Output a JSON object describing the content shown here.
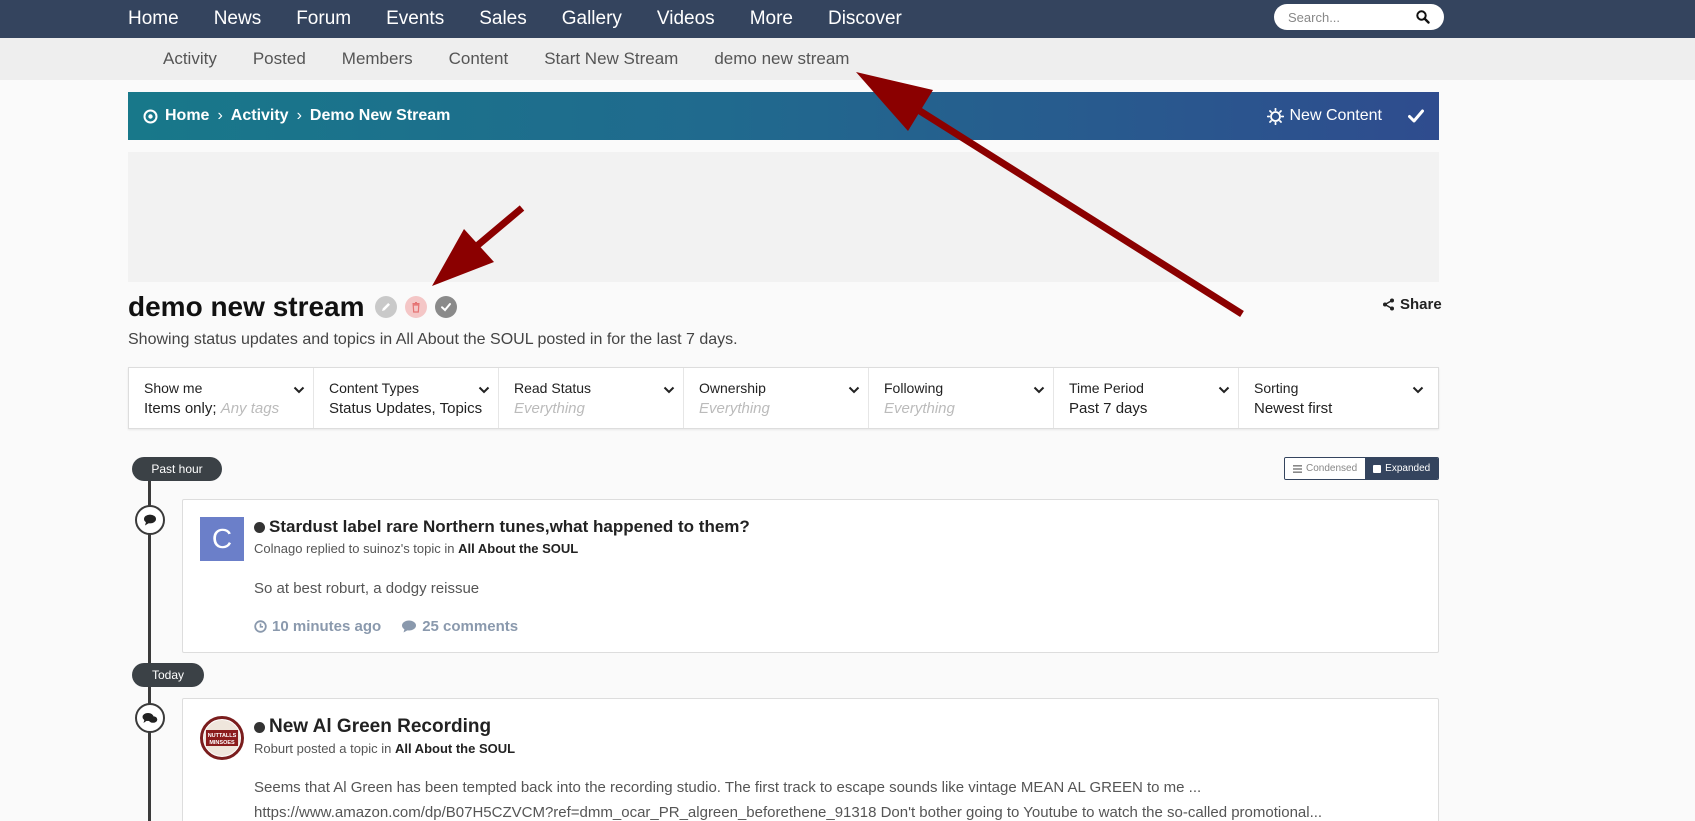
{
  "topnav": {
    "items": [
      "Home",
      "News",
      "Forum",
      "Events",
      "Sales",
      "Gallery",
      "Videos",
      "More",
      "Discover"
    ],
    "search_placeholder": "Search..."
  },
  "subnav": {
    "items": [
      "Activity",
      "Posted",
      "Members",
      "Content",
      "Start New Stream",
      "demo new stream"
    ]
  },
  "breadcrumb": {
    "items": [
      "Home",
      "Activity",
      "Demo New Stream"
    ],
    "new_content": "New Content"
  },
  "page": {
    "title": "demo new stream",
    "share": "Share",
    "subtitle": "Showing status updates and topics in All About the SOUL posted in for the last 7 days."
  },
  "filters": [
    {
      "label": "Show me",
      "value": "Items only;",
      "value_extra": "Any tags"
    },
    {
      "label": "Content Types",
      "value": "Status Updates, Topics"
    },
    {
      "label": "Read Status",
      "value": "Everything",
      "muted": true
    },
    {
      "label": "Ownership",
      "value": "Everything",
      "muted": true
    },
    {
      "label": "Following",
      "value": "Everything",
      "muted": true
    },
    {
      "label": "Time Period",
      "value": "Past 7 days"
    },
    {
      "label": "Sorting",
      "value": "Newest first"
    }
  ],
  "timeline": {
    "pills": [
      "Past hour",
      "Today"
    ],
    "view_condensed": "Condensed",
    "view_expanded": "Expanded"
  },
  "posts": [
    {
      "avatar_letter": "C",
      "avatar_color": "#6b7fc9",
      "title": "Stardust label rare Northern tunes,what happened to them?",
      "meta_prefix": "Colnago replied to suinoz's topic in",
      "meta_forum": "All About the SOUL",
      "body": "So at best roburt, a dodgy reissue",
      "time": "10 minutes ago",
      "comments": "25 comments"
    },
    {
      "avatar_text_top": "NUTTALLS",
      "avatar_text_bottom": "MINSOES",
      "title": "New Al Green Recording",
      "meta_prefix": "Roburt posted a topic in",
      "meta_forum": "All About the SOUL",
      "body_line1": "Seems that Al Green has been tempted back into the recording studio. The first track to escape sounds like vintage MEAN AL GREEN to me ...",
      "body_line2": "https://www.amazon.com/dp/B07H5CZVCM?ref=dmm_ocar_PR_algreen_beforethene_91318 Don't bother going to Youtube to watch the so-called promotional..."
    }
  ],
  "colors": {
    "topnav_bg": "#34445e",
    "crumb_gradient_start": "#18788a",
    "crumb_gradient_end": "#2f4c8e",
    "annotation_arrow": "#8b0000"
  }
}
